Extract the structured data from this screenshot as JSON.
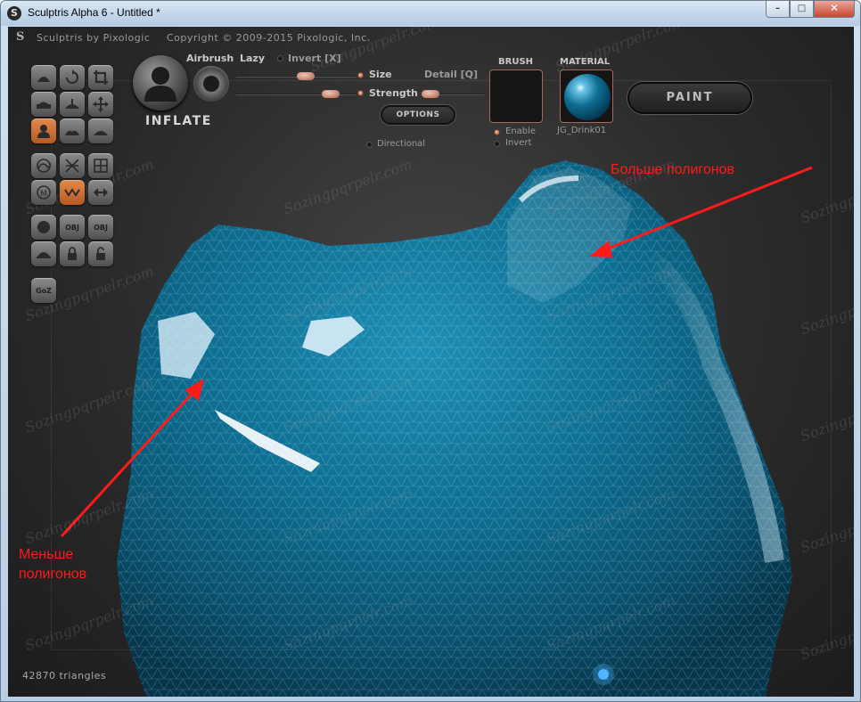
{
  "window": {
    "title": "Sculptris Alpha 6 - Untitled *",
    "icon": "sculptris-logo-icon",
    "controls": {
      "minimize": "–",
      "maximize": "□",
      "close": "✕"
    }
  },
  "infobar": {
    "logo": "S",
    "brand": "Sculptris by Pixologic",
    "copyright": "Copyright © 2009-2015 Pixologic, Inc."
  },
  "toolbar": {
    "buttons": [
      {
        "name": "draw-tool",
        "icon": "draw-icon"
      },
      {
        "name": "rotate-tool",
        "icon": "rotate-icon"
      },
      {
        "name": "crop-tool",
        "icon": "crop-icon"
      },
      {
        "name": "flatten-tool",
        "icon": "flatten-icon"
      },
      {
        "name": "pinch-tool",
        "icon": "pinch-icon"
      },
      {
        "name": "move-tool",
        "icon": "move-icon"
      },
      {
        "name": "inflate-tool",
        "icon": "inflate-icon",
        "active": true
      },
      {
        "name": "crease-tool",
        "icon": "crease-icon"
      },
      {
        "name": "smooth-tool",
        "icon": "smooth-icon"
      },
      {
        "name": "reduce-brush-tool",
        "icon": "reduce-brush-icon"
      },
      {
        "name": "reduce-selected-tool",
        "icon": "reduce-selected-icon"
      },
      {
        "name": "grid-tool",
        "icon": "grid-icon"
      },
      {
        "name": "mask-tool",
        "icon": "mask-icon"
      },
      {
        "name": "symmetry-tool",
        "icon": "symmetry-icon",
        "active": true
      },
      {
        "name": "mirror-tool",
        "icon": "mirror-icon"
      },
      {
        "name": "sphere-tool",
        "icon": "sphere-icon"
      },
      {
        "name": "import-obj-tool",
        "label": "OBJ"
      },
      {
        "name": "export-obj-tool",
        "label": "OBJ"
      },
      {
        "name": "plane-tool",
        "icon": "plane-icon"
      },
      {
        "name": "lock-tool",
        "icon": "lock-icon"
      },
      {
        "name": "unlock-tool",
        "icon": "unlock-icon"
      },
      {
        "name": "goz-tool",
        "label": "GoZ"
      }
    ]
  },
  "brush": {
    "name": "INFLATE",
    "airbrush": "Airbrush",
    "lazy": "Lazy",
    "invert": "Invert [X]",
    "size": "Size",
    "strength": "Strength",
    "detail": "Detail [Q]",
    "options": "OPTIONS",
    "directional": "Directional"
  },
  "panels": {
    "brush_title": "BRUSH",
    "material_title": "MATERIAL",
    "enable": "Enable",
    "invert": "Invert",
    "material_name": "JG_Drink01",
    "paint": "PAINT"
  },
  "annotations": {
    "more": "Больше полигонов",
    "less_1": "Меньше",
    "less_2": "полигонов"
  },
  "status": {
    "triangles": "42870 triangles"
  },
  "watermark": "Sozingpqrpelr.com",
  "colors": {
    "accent": "#d8773a",
    "mesh": "#0d6f91",
    "annotation": "#ff1a1a"
  }
}
